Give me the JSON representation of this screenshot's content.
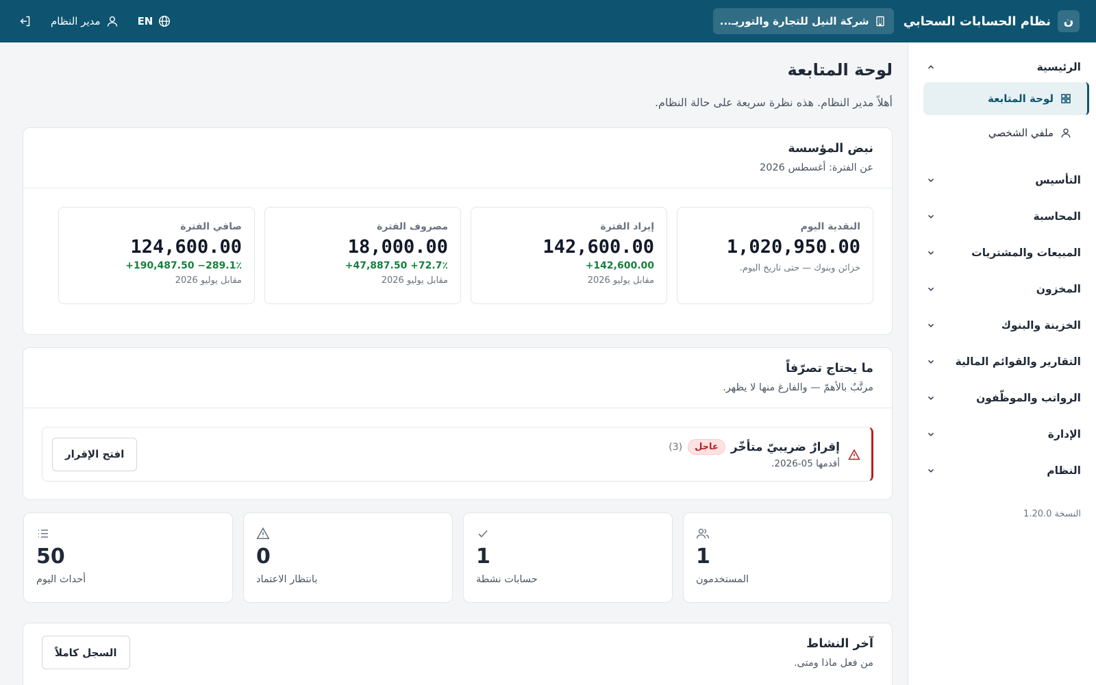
{
  "topbar": {
    "logo_letter": "ن",
    "app_title": "نظام الحسابات السحابي",
    "company": "شركة النيل للتجارة والتوريـ...",
    "user": "مدير النظام",
    "lang": "EN"
  },
  "sidebar": {
    "home": "الرئيسية",
    "dashboard": "لوحة المتابعة",
    "profile": "ملفي الشخصي",
    "groups": [
      "التأسيس",
      "المحاسبة",
      "المبيعات والمشتريات",
      "المخزون",
      "الخزينة والبنوك",
      "التقارير والقوائم المالية",
      "الرواتب والموظّفون",
      "الإدارة",
      "النظام"
    ],
    "version": "النسخة 1.20.0"
  },
  "page": {
    "title": "لوحة المتابعة",
    "subtitle": "أهلاً مدير النظام. هذه نظرة سريعة على حالة النظام."
  },
  "pulse": {
    "title": "نبض المؤسسة",
    "period": "عن الفترة: أغسطس 2026",
    "cash": {
      "label": "النقدية اليوم",
      "value": "1,020,950.00",
      "note": "خزائن وبنوك — حتى تاريخ اليوم."
    },
    "revenue": {
      "label": "إيراد الفترة",
      "value": "142,600.00",
      "delta": "+142,600.00",
      "note": "مقابل يوليو 2026"
    },
    "expense": {
      "label": "مصروف الفترة",
      "value": "18,000.00",
      "delta": "+47,887.50 +72.7٪",
      "note": "مقابل يوليو 2026"
    },
    "net": {
      "label": "صافي الفترة",
      "value": "124,600.00",
      "delta": "+190,487.50 −289.1٪",
      "note": "مقابل يوليو 2026"
    }
  },
  "actions": {
    "title": "ما يحتاج تصرّفاً",
    "subtitle": "مرتَّبٌ بالأهمّ — والفارغ منها لا يظهر.",
    "alert": {
      "title": "إقرارٌ ضريبيّ متأخّر",
      "badge": "عاجل",
      "count": "(3)",
      "sub": "أقدمها 05-2026.",
      "button": "افتح الإقرار"
    }
  },
  "stats": {
    "users": {
      "value": "1",
      "label": "المستخدمون"
    },
    "accounts": {
      "value": "1",
      "label": "حسابات نشطة"
    },
    "pending": {
      "value": "0",
      "label": "بانتظار الاعتماد"
    },
    "events": {
      "value": "50",
      "label": "أحداث اليوم"
    }
  },
  "activity": {
    "title": "آخر النشاط",
    "subtitle": "من فعل ماذا ومتى.",
    "button": "السجل كاملاً"
  },
  "colors": {
    "brand": "#0e5470",
    "positive": "#15803d",
    "danger": "#b91c1c"
  }
}
